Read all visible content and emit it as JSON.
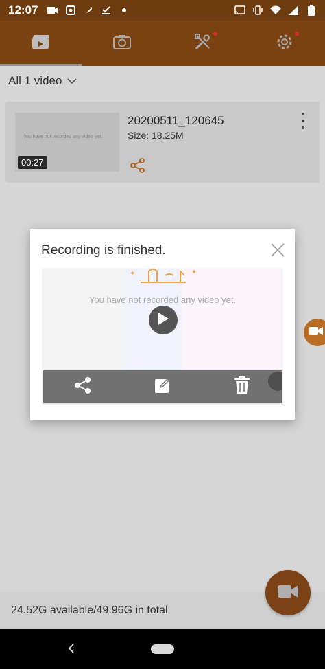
{
  "status_bar": {
    "time": "12:07",
    "left_icons": [
      "video-camera-icon",
      "app-notification-icon",
      "feather-icon",
      "download-done-icon",
      "dot-icon"
    ],
    "right_icons": [
      "cast-icon",
      "vibrate-icon",
      "wifi-icon",
      "signal-icon",
      "battery-icon"
    ]
  },
  "toolbar": {
    "tabs": [
      {
        "name": "videos",
        "icon": "clapperboard-icon",
        "active": true
      },
      {
        "name": "photos",
        "icon": "camera-icon",
        "active": false
      },
      {
        "name": "tools",
        "icon": "tools-icon",
        "active": false,
        "badge": true
      },
      {
        "name": "settings",
        "icon": "gear-icon",
        "active": false,
        "badge": true
      }
    ]
  },
  "filter": {
    "label": "All 1 video"
  },
  "video_card": {
    "title": "20200511_120645",
    "size": "Size: 18.25M",
    "duration": "00:27",
    "thumb_text": "You have not recorded any video yet."
  },
  "storage": {
    "text": "24.52G available/49.96G in total"
  },
  "dialog": {
    "title": "Recording is finished.",
    "preview_text": "You have not recorded any video yet.",
    "actions": [
      "share-icon",
      "edit-icon",
      "trash-icon"
    ]
  },
  "colors": {
    "accent": "#7a4211",
    "status_bar": "#6e3c0e",
    "share_orange": "#b0601c"
  }
}
